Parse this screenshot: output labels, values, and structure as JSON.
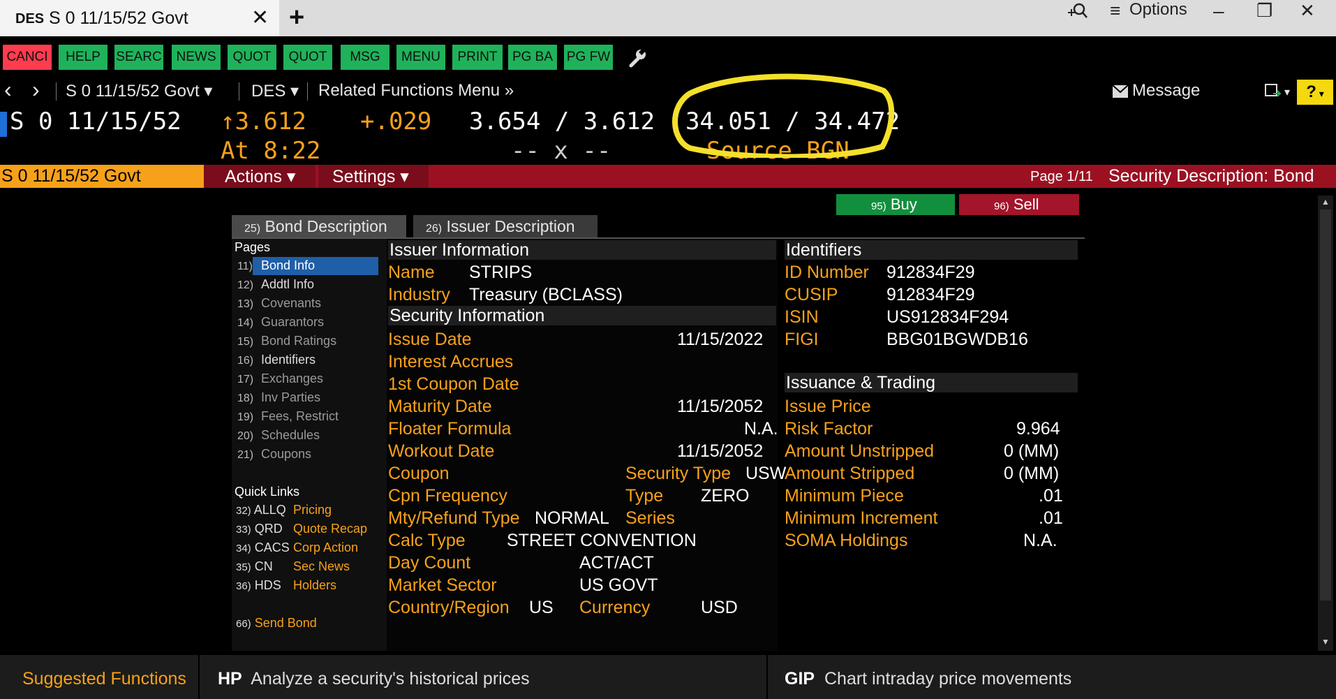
{
  "window": {
    "tab_code": "DES",
    "tab_title": "S 0 11/15/52 Govt",
    "close_glyph": "✕",
    "plus_glyph": "+",
    "options_label": "Options",
    "minimize": "–",
    "restore": "❐",
    "close": "✕"
  },
  "toolbar": {
    "buttons": [
      "CANCI",
      "HELP",
      "SEARC",
      "NEWS",
      "QUOT",
      "QUOT",
      "MSG",
      "MENU",
      "PRINT",
      "PG BA",
      "PG FW"
    ]
  },
  "nav": {
    "back": "‹",
    "forward": "›",
    "security": "S 0 11/15/52 Govt ▾",
    "function": "DES ▾",
    "related": "Related Functions Menu »",
    "message": "Message",
    "help": "?"
  },
  "quote": {
    "ticker": "S 0 11/15/52",
    "price": "↑3.612",
    "time": "At 8:22",
    "change": "+.029",
    "bid_ask_yield": "3.654 / 3.612",
    "bid_ask_yield_sub": "-- x --",
    "bid_ask_price": "34.051 / 34.472",
    "source": "Source BGN"
  },
  "band": {
    "ticker": "S 0 11/15/52 Govt",
    "actions": "Actions ▾",
    "settings": "Settings ▾",
    "page": "Page 1/11",
    "desc": "Security Description: Bond"
  },
  "trade": {
    "buy_num": "95)",
    "buy": "Buy",
    "sell_num": "96)",
    "sell": "Sell"
  },
  "desc_tabs": [
    {
      "num": "25)",
      "label": "Bond Description"
    },
    {
      "num": "26)",
      "label": "Issuer Description"
    }
  ],
  "pages": {
    "title": "Pages",
    "items": [
      {
        "num": "11)",
        "label": "Bond Info"
      },
      {
        "num": "12)",
        "label": "Addtl Info"
      },
      {
        "num": "13)",
        "label": "Covenants"
      },
      {
        "num": "14)",
        "label": "Guarantors"
      },
      {
        "num": "15)",
        "label": "Bond Ratings"
      },
      {
        "num": "16)",
        "label": "Identifiers"
      },
      {
        "num": "17)",
        "label": "Exchanges"
      },
      {
        "num": "18)",
        "label": "Inv Parties"
      },
      {
        "num": "19)",
        "label": "Fees, Restrict"
      },
      {
        "num": "20)",
        "label": "Schedules"
      },
      {
        "num": "21)",
        "label": "Coupons"
      }
    ]
  },
  "quick_links": {
    "title": "Quick Links",
    "items": [
      {
        "num": "32)",
        "code": "ALLQ",
        "label": "Pricing"
      },
      {
        "num": "33)",
        "code": "QRD",
        "label": "Quote Recap"
      },
      {
        "num": "34)",
        "code": "CACS",
        "label": "Corp Action"
      },
      {
        "num": "35)",
        "code": "CN",
        "label": "Sec News"
      },
      {
        "num": "36)",
        "code": "HDS",
        "label": "Holders"
      }
    ],
    "send_num": "66)",
    "send": "Send Bond"
  },
  "issuer": {
    "header": "Issuer Information",
    "name_label": "Name",
    "name": "STRIPS",
    "industry_label": "Industry",
    "industry": "Treasury (BCLASS)"
  },
  "security": {
    "header": "Security Information",
    "issue_date_label": "Issue Date",
    "issue_date": "11/15/2022",
    "interest_accrues_label": "Interest Accrues",
    "first_coupon_label": "1st Coupon Date",
    "maturity_label": "Maturity Date",
    "maturity": "11/15/2052",
    "floater_label": "Floater Formula",
    "floater": "N.A.",
    "workout_label": "Workout Date",
    "workout": "11/15/2052",
    "coupon_label": "Coupon",
    "sec_type_label": "Security Type",
    "sec_type": "USW",
    "cpn_freq_label": "Cpn Frequency",
    "type_label": "Type",
    "type": "ZERO",
    "mty_label": "Mty/Refund Type",
    "mty": "NORMAL",
    "series_label": "Series",
    "calc_label": "Calc Type",
    "calc": "STREET CONVENTION",
    "day_count_label": "Day Count",
    "day_count": "ACT/ACT",
    "market_label": "Market Sector",
    "market": "US GOVT",
    "country_label": "Country/Region",
    "country": "US",
    "currency_label": "Currency",
    "currency": "USD"
  },
  "identifiers": {
    "header": "Identifiers",
    "id_label": "ID Number",
    "id": "912834F29",
    "cusip_label": "CUSIP",
    "cusip": "912834F29",
    "isin_label": "ISIN",
    "isin": "US912834F294",
    "figi_label": "FIGI",
    "figi": "BBG01BGWDB16"
  },
  "issuance": {
    "header": "Issuance & Trading",
    "issue_price_label": "Issue Price",
    "risk_label": "Risk Factor",
    "risk": "9.964",
    "unstripped_label": "Amount Unstripped",
    "unstripped": "0 (MM)",
    "stripped_label": "Amount Stripped",
    "stripped": "0 (MM)",
    "min_piece_label": "Minimum Piece",
    "min_piece": ".01",
    "min_inc_label": "Minimum Increment",
    "min_inc": ".01",
    "soma_label": "SOMA Holdings",
    "soma": "N.A."
  },
  "bottom": {
    "suggested": "Suggested Functions",
    "f1_code": "HP",
    "f1_desc": "Analyze a security's historical prices",
    "f2_code": "GIP",
    "f2_desc": "Chart intraday price movements"
  },
  "colors": {
    "accent_orange": "#f7a11a",
    "band_red": "#9b1122",
    "button_green": "#1fb25a",
    "highlight_yellow": "#f5e02a"
  }
}
